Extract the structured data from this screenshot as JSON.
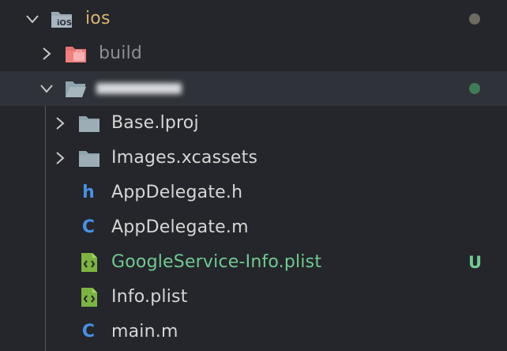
{
  "explorer": {
    "ios": {
      "label": "ios",
      "icon": "ios-folder-icon",
      "dot_color": "#6e6b62"
    },
    "build": {
      "label": "build",
      "icon": "build-folder-icon"
    },
    "app": {
      "label": "",
      "icon": "open-folder-icon",
      "dot_color": "#3f7b57"
    },
    "base_lproj": {
      "label": "Base.lproj",
      "icon": "folder-icon"
    },
    "images": {
      "label": "Images.xcassets",
      "icon": "folder-icon"
    },
    "appdelegate_h": {
      "label": "AppDelegate.h",
      "icon": "h-file-icon"
    },
    "appdelegate_m": {
      "label": "AppDelegate.m",
      "icon": "c-file-icon"
    },
    "google_plist": {
      "label": "GoogleService-Info.plist",
      "icon": "plist-file-icon",
      "status": "U"
    },
    "info_plist": {
      "label": "Info.plist",
      "icon": "plist-file-icon"
    },
    "main_m": {
      "label": "main.m",
      "icon": "c-file-icon"
    }
  },
  "colors": {
    "background": "#24262b",
    "selected_row": "#2f3238",
    "folder": "#90a4ae",
    "file_letter": "#4a90e2",
    "plist_green": "#7cb342",
    "untracked": "#73c991",
    "ios_label": "#d9b474"
  }
}
